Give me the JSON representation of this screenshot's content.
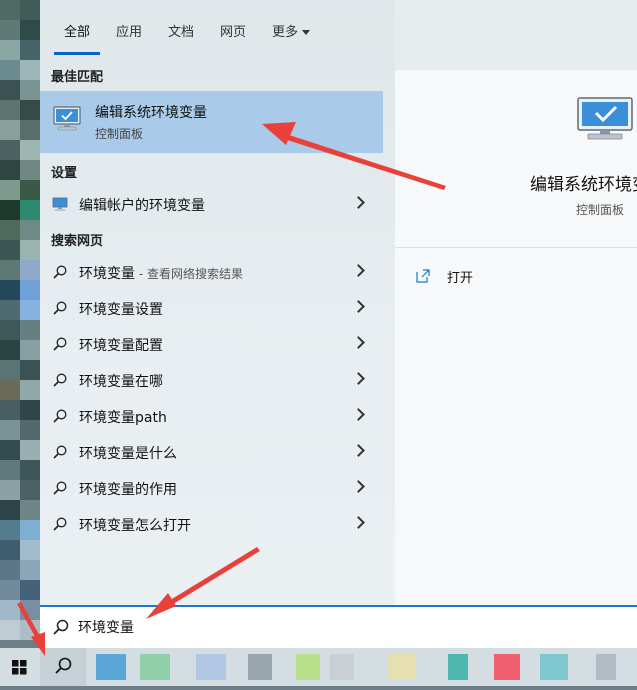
{
  "tabs": [
    {
      "label": "全部",
      "active": true
    },
    {
      "label": "应用"
    },
    {
      "label": "文档"
    },
    {
      "label": "网页"
    },
    {
      "label": "更多"
    }
  ],
  "sections": {
    "best_match": "最佳匹配",
    "settings": "设置",
    "web": "搜索网页"
  },
  "best_match": {
    "title": "编辑系统环境变量",
    "subtitle": "控制面板",
    "icon": "monitor-check-icon"
  },
  "settings_items": [
    {
      "label": "编辑帐户的环境变量",
      "icon": "monitor-icon"
    }
  ],
  "web_results": [
    {
      "label": "环境变量",
      "suffix": " - 查看网络搜索结果"
    },
    {
      "label": "环境变量设置"
    },
    {
      "label": "环境变量配置"
    },
    {
      "label": "环境变量在哪"
    },
    {
      "label": "环境变量path"
    },
    {
      "label": "环境变量是什么"
    },
    {
      "label": "环境变量的作用"
    },
    {
      "label": "环境变量怎么打开"
    }
  ],
  "preview": {
    "title": "编辑系统环境变量",
    "subtitle": "控制面板",
    "action_open": "打开"
  },
  "search": {
    "value": "环境变量"
  },
  "colors": {
    "accent": "#1a76d2",
    "selection": "#a9cbe9",
    "arrow": "#e8413a"
  }
}
